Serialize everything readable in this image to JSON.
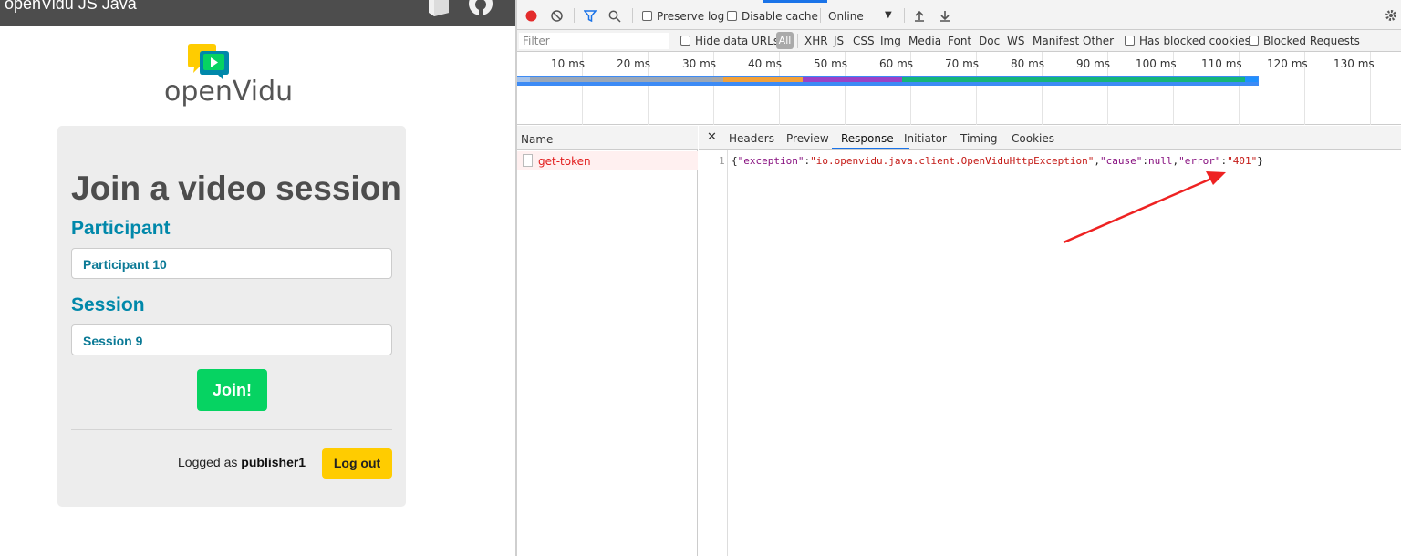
{
  "app": {
    "title": "openVidu JS Java",
    "logo_text": "openVidu",
    "card_title": "Join a video session",
    "participant_label": "Participant",
    "participant_value": "Participant 10",
    "session_label": "Session",
    "session_value": "Session 9",
    "join_label": "Join!",
    "logged_prefix": "Logged as",
    "logged_user": "publisher1",
    "logout_label": "Log out",
    "colors": {
      "accent": "#0088aa",
      "join": "#06d362",
      "logout": "#ffcc00"
    }
  },
  "devtools": {
    "toolbar": {
      "preserve_log": "Preserve log",
      "disable_cache": "Disable cache",
      "throttle": "Online"
    },
    "filter": {
      "placeholder": "Filter",
      "hide_data_urls": "Hide data URLs",
      "all": "All",
      "types": [
        "XHR",
        "JS",
        "CSS",
        "Img",
        "Media",
        "Font",
        "Doc",
        "WS",
        "Manifest",
        "Other"
      ],
      "has_blocked_cookies": "Has blocked cookies",
      "blocked_requests": "Blocked Requests"
    },
    "timeline_ticks": [
      "10 ms",
      "20 ms",
      "30 ms",
      "40 ms",
      "50 ms",
      "60 ms",
      "70 ms",
      "80 ms",
      "90 ms",
      "100 ms",
      "110 ms",
      "120 ms",
      "130 ms"
    ],
    "name_header": "Name",
    "request_name": "get-token",
    "tabs": [
      "Headers",
      "Preview",
      "Response",
      "Initiator",
      "Timing",
      "Cookies"
    ],
    "active_tab": "Response",
    "response": {
      "line_number": "1",
      "exception_key": "\"exception\"",
      "exception_val": "\"io.openvidu.java.client.OpenViduHttpException\"",
      "cause_key": "\"cause\"",
      "cause_val": "null",
      "error_key": "\"error\"",
      "error_val": "\"401\""
    }
  }
}
